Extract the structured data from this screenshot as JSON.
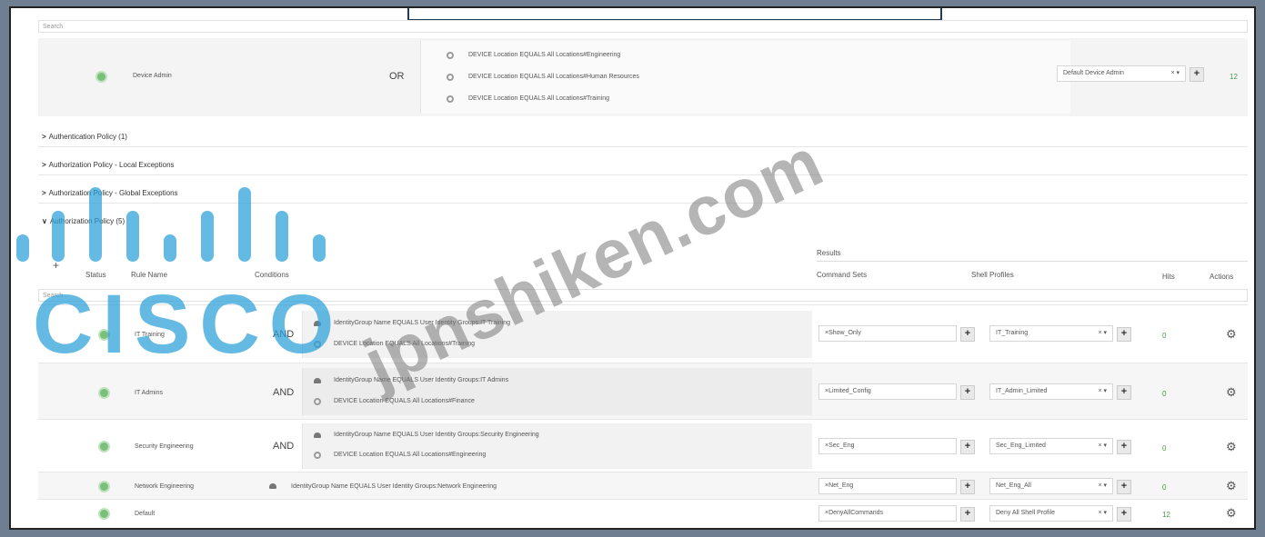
{
  "search_placeholder": "Search",
  "device_admin_row": {
    "name": "Device Admin",
    "operator": "OR",
    "conditions": [
      "DEVICE Location EQUALS All Locations#Engineering",
      "DEVICE Location EQUALS All Locations#Human Resources",
      "DEVICE Location EQUALS All Locations#Training"
    ],
    "result": "Default Device Admin",
    "hits": "12"
  },
  "sections": [
    {
      "label": "Authentication Policy (1)",
      "expanded": false
    },
    {
      "label": "Authorization Policy - Local Exceptions",
      "expanded": false
    },
    {
      "label": "Authorization Policy - Global Exceptions",
      "expanded": false
    },
    {
      "label": "Authorization Policy (5)",
      "expanded": true
    }
  ],
  "table": {
    "results_label": "Results",
    "headers": {
      "status": "Status",
      "rule_name": "Rule Name",
      "conditions": "Conditions",
      "command_sets": "Command Sets",
      "shell_profiles": "Shell Profiles",
      "hits": "Hits",
      "actions": "Actions"
    },
    "search_placeholder": "Search",
    "rows": [
      {
        "name": "IT Training",
        "operator": "AND",
        "conditions": [
          "IdentityGroup Name EQUALS User Identity Groups:IT Training",
          "DEVICE Location EQUALS All Locations#Training"
        ],
        "command_set": "×Show_Only",
        "shell_profile": "IT_Training",
        "hits": "0"
      },
      {
        "name": "IT Admins",
        "operator": "AND",
        "conditions": [
          "IdentityGroup Name EQUALS User Identity Groups:IT Admins",
          "DEVICE Location EQUALS All Locations#Finance"
        ],
        "command_set": "×Limited_Config",
        "shell_profile": "IT_Admin_Limited",
        "hits": "0"
      },
      {
        "name": "Security Engineering",
        "operator": "AND",
        "conditions": [
          "IdentityGroup Name EQUALS User Identity Groups:Security Engineering",
          "DEVICE Location EQUALS All Locations#Engineering"
        ],
        "command_set": "×Sec_Eng",
        "shell_profile": "Sec_Eng_Limited",
        "hits": "0"
      },
      {
        "name": "Network Engineering",
        "operator": "",
        "conditions": [
          "IdentityGroup Name EQUALS User Identity Groups:Network Engineering"
        ],
        "command_set": "×Net_Eng",
        "shell_profile": "Net_Eng_All",
        "hits": "0"
      },
      {
        "name": "Default",
        "operator": "",
        "conditions": [],
        "command_set": "×DenyAllCommands",
        "shell_profile": "Deny All Shell Profile",
        "hits": "12"
      }
    ]
  },
  "watermark": "jpnshiken.com",
  "logo_text": "CISCO",
  "colors": {
    "background": "#6f7e90",
    "status_ok": "#7ac07a",
    "hits_green": "#4a9a4a",
    "logo_blue": "#29a0d8"
  }
}
